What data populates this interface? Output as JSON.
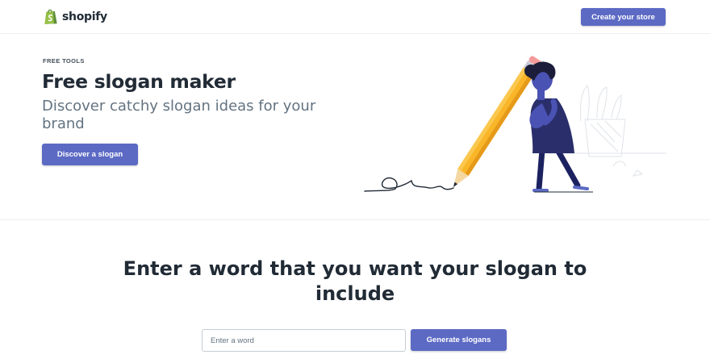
{
  "header": {
    "logo_text": "shopify",
    "cta_label": "Create your store"
  },
  "hero": {
    "eyebrow": "FREE TOOLS",
    "title": "Free slogan maker",
    "subtitle": "Discover catchy slogan ideas for your brand",
    "cta_label": "Discover a slogan"
  },
  "generator": {
    "title": "Enter a word that you want your slogan to include",
    "input_placeholder": "Enter a word",
    "input_value": "",
    "button_label": "Generate slogans"
  },
  "colors": {
    "accent": "#5c6ac4",
    "brand_green": "#95bf47",
    "pencil": "#f9b629"
  },
  "icons": {
    "logo": "shopify-bag-icon",
    "illustration": "woman-with-giant-pencil-illustration"
  }
}
